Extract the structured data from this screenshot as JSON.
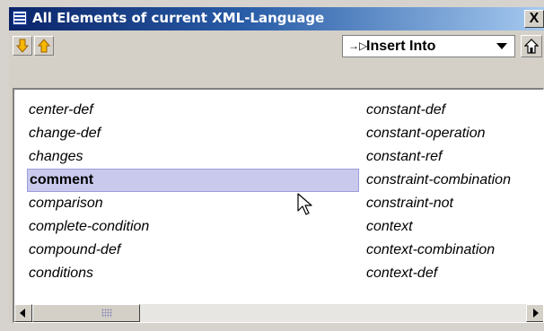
{
  "window": {
    "title": "All Elements of current XML-Language",
    "close_label": "X"
  },
  "toolbar": {
    "move_down_icon": "arrow-down-icon",
    "move_up_icon": "arrow-up-icon",
    "insert_mode": {
      "selected": "Insert Into",
      "icon": "→▷"
    },
    "home_icon": "home-icon"
  },
  "elements": {
    "left": [
      "center-def",
      "change-def",
      "changes",
      "comment",
      "comparison",
      "complete-condition",
      "compound-def",
      "conditions"
    ],
    "right": [
      "constant-def",
      "constant-operation",
      "constant-ref",
      "constraint-combination",
      "constraint-not",
      "context",
      "context-combination",
      "context-def"
    ],
    "selected": "comment"
  },
  "colors": {
    "title_bar": "#0a246a",
    "selection": "#c9c9ee",
    "arrow_icon": "#e8a000"
  }
}
